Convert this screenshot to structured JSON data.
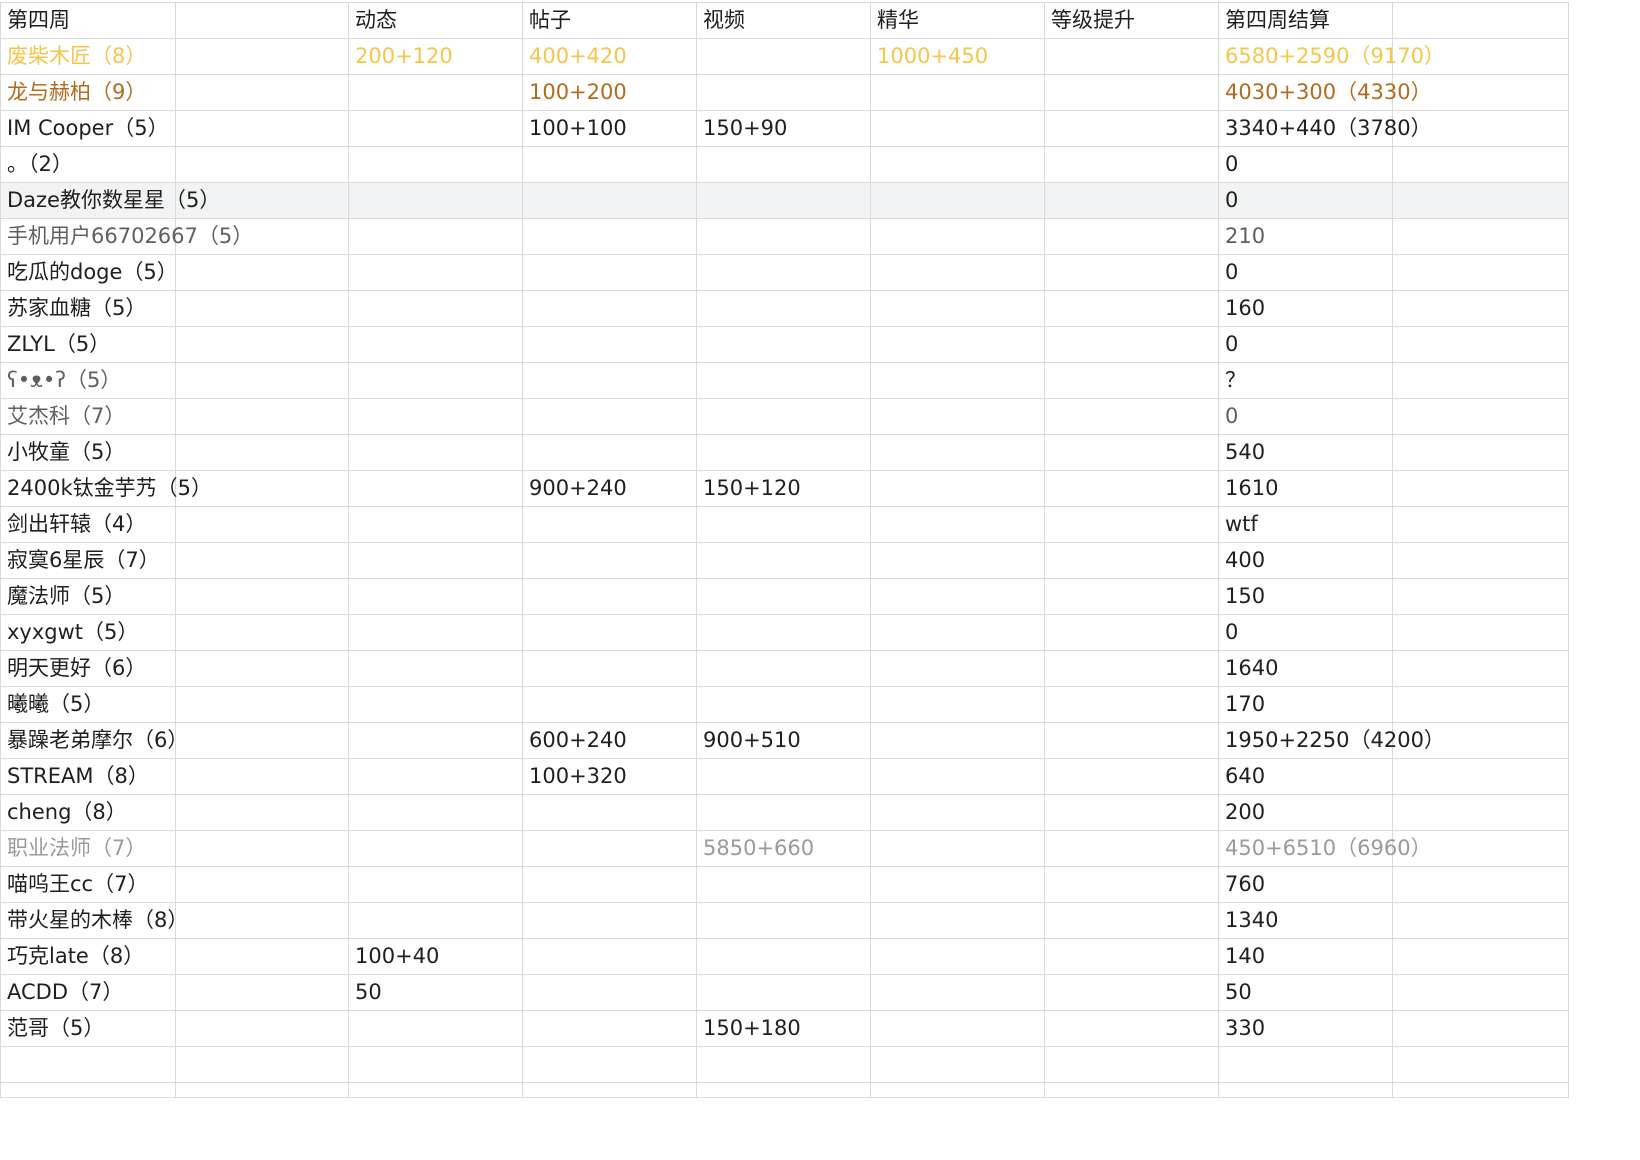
{
  "colors": {
    "gold": "#f5c64c",
    "brown": "#b26b1f",
    "gray": "#9a9a9a",
    "dim": "#5f5f5f",
    "text": "#1f1f1f",
    "grid": "#d9d9d9",
    "highlight": "#f1f3f4"
  },
  "header": [
    "第四周",
    "动态",
    "帖子",
    "视频",
    "精华",
    "等级提升",
    "第四周结算"
  ],
  "rows": [
    {
      "name": "废柴木匠（8）",
      "dongtai": "200+120",
      "tiezi": "400+420",
      "shipin": "",
      "jinghua": "1000+450",
      "dengji": "",
      "jiesuan": "6580+2590（9170）",
      "color": "#f5c64c"
    },
    {
      "name": "龙与赫柏（9）",
      "dongtai": "",
      "tiezi": "100+200",
      "shipin": "",
      "jinghua": "",
      "dengji": "",
      "jiesuan": "4030+300（4330）",
      "color": "#b26b1f"
    },
    {
      "name": "IM Cooper（5）",
      "dongtai": "",
      "tiezi": "100+100",
      "shipin": "150+90",
      "jinghua": "",
      "dengji": "",
      "jiesuan": "3340+440（3780）"
    },
    {
      "name": "。（2）",
      "dongtai": "",
      "tiezi": "",
      "shipin": "",
      "jinghua": "",
      "dengji": "",
      "jiesuan": "0"
    },
    {
      "name": "Daze教你数星星（5）",
      "dongtai": "",
      "tiezi": "",
      "shipin": "",
      "jinghua": "",
      "dengji": "",
      "jiesuan": "0",
      "highlight": true,
      "span": true
    },
    {
      "name": "手机用户66702667（5）",
      "dongtai": "",
      "tiezi": "",
      "shipin": "",
      "jinghua": "",
      "dengji": "",
      "jiesuan": "210",
      "color": "#5f5f5f",
      "span": true
    },
    {
      "name": "吃瓜的doge（5）",
      "dongtai": "",
      "tiezi": "",
      "shipin": "",
      "jinghua": "",
      "dengji": "",
      "jiesuan": "0",
      "span": true
    },
    {
      "name": "苏家血糖（5）",
      "dongtai": "",
      "tiezi": "",
      "shipin": "",
      "jinghua": "",
      "dengji": "",
      "jiesuan": "160"
    },
    {
      "name": "ZLYL（5）",
      "dongtai": "",
      "tiezi": "",
      "shipin": "",
      "jinghua": "",
      "dengji": "",
      "jiesuan": "0"
    },
    {
      "name": "ʕ•ᴥ•ʔ（5）",
      "dongtai": "",
      "tiezi": "",
      "shipin": "",
      "jinghua": "",
      "dengji": "",
      "jiesuan": "？",
      "namecolor": "#5f5f5f"
    },
    {
      "name": "艾杰科（7）",
      "dongtai": "",
      "tiezi": "",
      "shipin": "",
      "jinghua": "",
      "dengji": "",
      "jiesuan": "0",
      "color": "#5f5f5f"
    },
    {
      "name": "小牧童（5）",
      "dongtai": "",
      "tiezi": "",
      "shipin": "",
      "jinghua": "",
      "dengji": "",
      "jiesuan": "540"
    },
    {
      "name": "2400k钛金芋艿（5）",
      "dongtai": "",
      "tiezi": "900+240",
      "shipin": "150+120",
      "jinghua": "",
      "dengji": "",
      "jiesuan": "1610"
    },
    {
      "name": "剑出轩辕（4）",
      "dongtai": "",
      "tiezi": "",
      "shipin": "",
      "jinghua": "",
      "dengji": "",
      "jiesuan": "wtf"
    },
    {
      "name": "寂寞6星辰（7）",
      "dongtai": "",
      "tiezi": "",
      "shipin": "",
      "jinghua": "",
      "dengji": "",
      "jiesuan": "400"
    },
    {
      "name": "魔法师（5）",
      "dongtai": "",
      "tiezi": "",
      "shipin": "",
      "jinghua": "",
      "dengji": "",
      "jiesuan": "150"
    },
    {
      "name": "xyxgwt（5）",
      "dongtai": "",
      "tiezi": "",
      "shipin": "",
      "jinghua": "",
      "dengji": "",
      "jiesuan": "0"
    },
    {
      "name": "明天更好（6）",
      "dongtai": "",
      "tiezi": "",
      "shipin": "",
      "jinghua": "",
      "dengji": "",
      "jiesuan": "1640"
    },
    {
      "name": "曦曦（5）",
      "dongtai": "",
      "tiezi": "",
      "shipin": "",
      "jinghua": "",
      "dengji": "",
      "jiesuan": "170"
    },
    {
      "name": "暴躁老弟摩尔（6）",
      "dongtai": "",
      "tiezi": "600+240",
      "shipin": "900+510",
      "jinghua": "",
      "dengji": "",
      "jiesuan": "1950+2250（4200）"
    },
    {
      "name": "STREAM（8）",
      "dongtai": "",
      "tiezi": "100+320",
      "shipin": "",
      "jinghua": "",
      "dengji": "",
      "jiesuan": "640"
    },
    {
      "name": "cheng（8）",
      "dongtai": "",
      "tiezi": "",
      "shipin": "",
      "jinghua": "",
      "dengji": "",
      "jiesuan": "200"
    },
    {
      "name": "职业法师（7）",
      "dongtai": "",
      "tiezi": "",
      "shipin": "5850+660",
      "jinghua": "",
      "dengji": "",
      "jiesuan": "450+6510（6960）",
      "color": "#9a9a9a"
    },
    {
      "name": "喵呜王cc（7）",
      "dongtai": "",
      "tiezi": "",
      "shipin": "",
      "jinghua": "",
      "dengji": "",
      "jiesuan": "760"
    },
    {
      "name": "带火星的木棒（8）",
      "dongtai": "",
      "tiezi": "",
      "shipin": "",
      "jinghua": "",
      "dengji": "",
      "jiesuan": "1340",
      "span": true
    },
    {
      "name": "巧克late（8）",
      "dongtai": "100+40",
      "tiezi": "",
      "shipin": "",
      "jinghua": "",
      "dengji": "",
      "jiesuan": "140"
    },
    {
      "name": "ACDD（7）",
      "dongtai": "50",
      "tiezi": "",
      "shipin": "",
      "jinghua": "",
      "dengji": "",
      "jiesuan": "50"
    },
    {
      "name": "范哥（5）",
      "dongtai": "",
      "tiezi": "",
      "shipin": "150+180",
      "jinghua": "",
      "dengji": "",
      "jiesuan": "330"
    }
  ]
}
